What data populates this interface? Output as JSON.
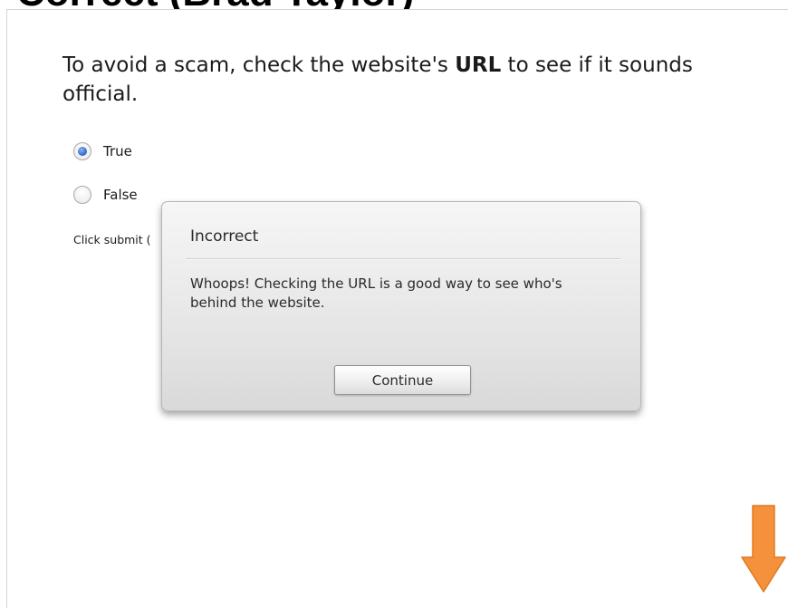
{
  "header": {
    "title": "Correct (Brad Taylor)"
  },
  "question": {
    "text_before": "To avoid a scam, check the website's ",
    "term": "URL",
    "text_after": " to see if it sounds official."
  },
  "options": [
    {
      "label": "True",
      "checked": true
    },
    {
      "label": "False",
      "checked": false
    }
  ],
  "hint": "Click submit (",
  "dialog": {
    "title": "Incorrect",
    "message": "Whoops! Checking the URL is a good way to see who's behind the website.",
    "button_label": "Continue"
  },
  "colors": {
    "radio_selected": "#2c63c8",
    "arrow": "#f5913c"
  },
  "icons": {
    "next_arrow": "arrow-down-icon"
  }
}
